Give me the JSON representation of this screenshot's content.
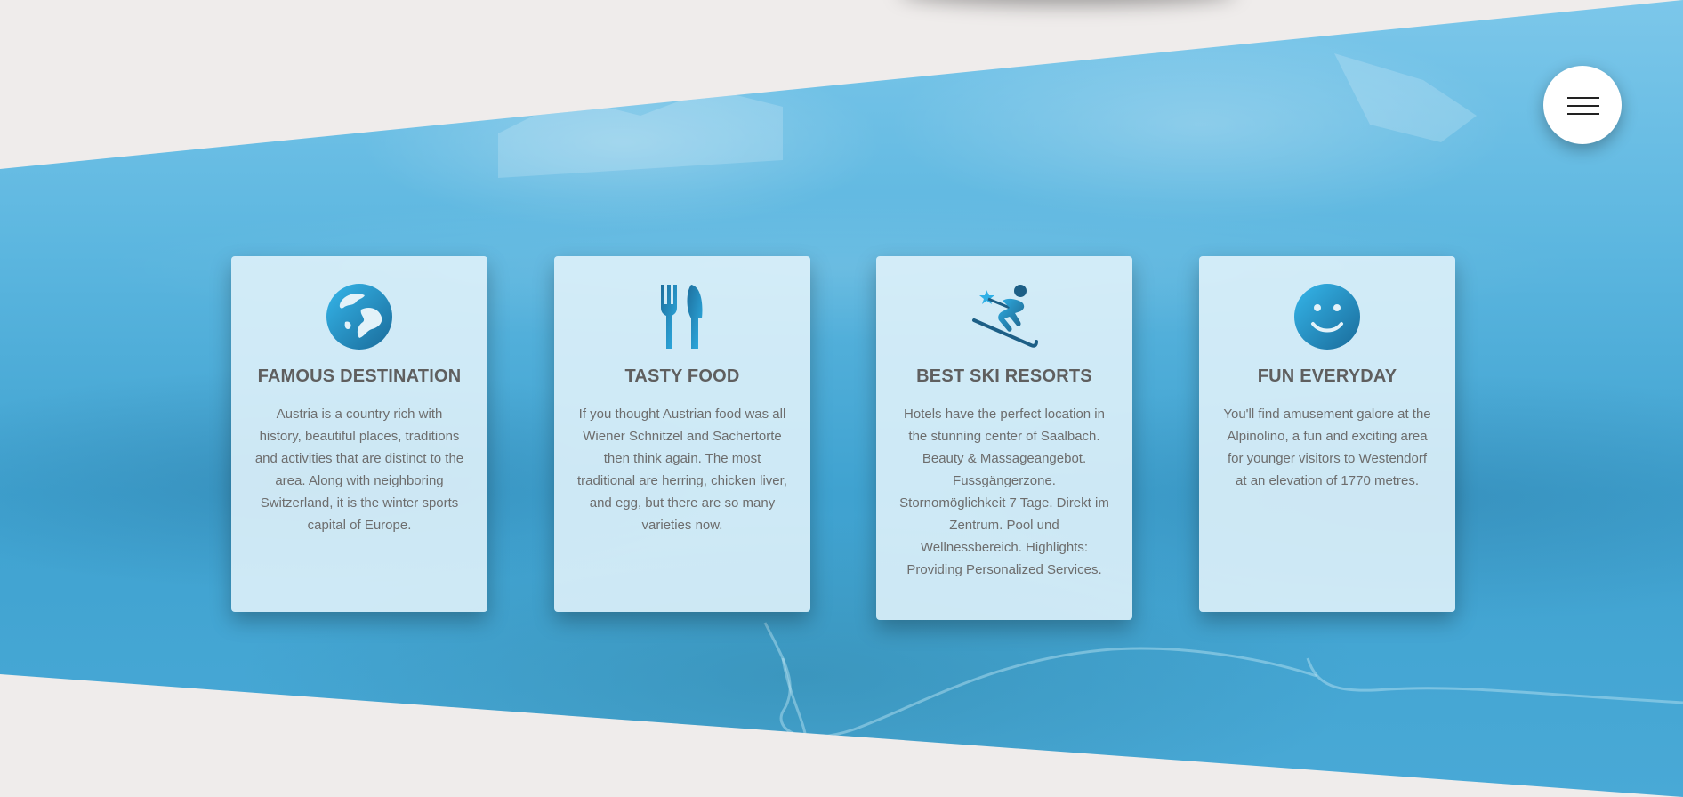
{
  "colors": {
    "background": "#efeceb",
    "band_top": "#7cc7ea",
    "band_mid": "#3fa2d0",
    "card_bg": "rgba(225,242,250,0.88)",
    "icon_dark": "#1d6e9c",
    "icon_light": "#2fb0e6",
    "heading_text": "#5f5f5f",
    "body_text": "#6d6d6d"
  },
  "menu": {
    "icon": "hamburger-menu-icon"
  },
  "cards": [
    {
      "icon": "globe-icon",
      "title": "FAMOUS DESTINATION",
      "text": "Austria is a country rich with history, beautiful places, traditions and activities that are distinct to the area. Along with neighboring Switzerland, it is the winter sports capital of Europe."
    },
    {
      "icon": "fork-knife-icon",
      "title": "TASTY FOOD",
      "text": "If you thought Austrian food was all Wiener Schnitzel and Sachertorte then think again. The most traditional are herring, chicken liver, and egg, but there are so many varieties now."
    },
    {
      "icon": "skier-icon",
      "title": "BEST SKI RESORTS",
      "text": "Hotels have the perfect location in the stunning center of Saalbach. Beauty & Massageangebot. Fussgängerzone. Stornomöglichkeit 7 Tage. Direkt im Zentrum. Pool und Wellnessbereich. Highlights: Providing Personalized Services."
    },
    {
      "icon": "smiley-icon",
      "title": "FUN EVERYDAY",
      "text": "You'll find amusement galore at the Alpinolino, a fun and exciting area for younger visitors to Westendorf at an elevation of 1770 metres."
    }
  ]
}
